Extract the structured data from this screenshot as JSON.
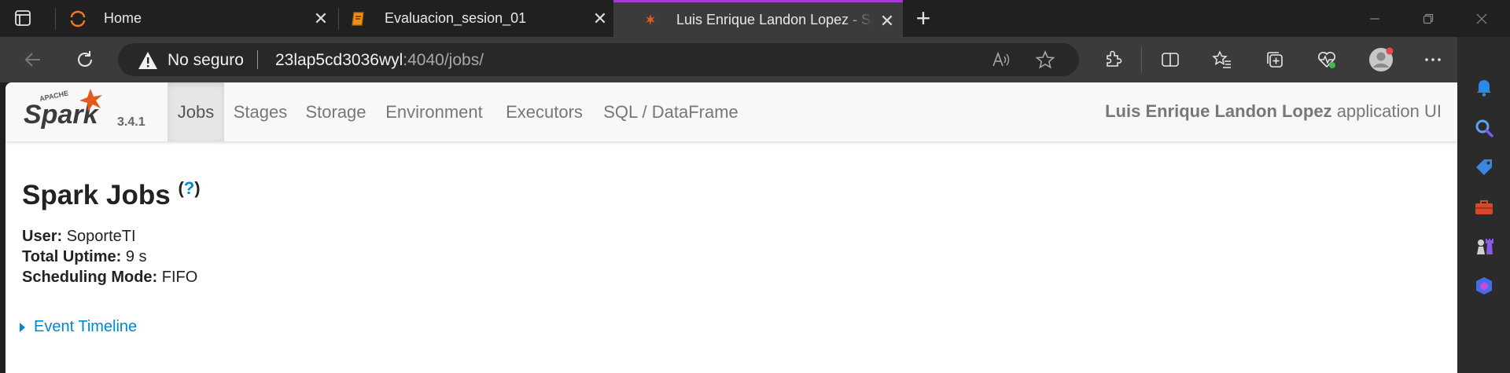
{
  "browser": {
    "tabs": [
      {
        "title": "Home",
        "icon": "jupyter-icon"
      },
      {
        "title": "Evaluacion_sesion_01",
        "icon": "notebook-icon"
      },
      {
        "title": "Luis Enrique Landon Lopez - Spark Jobs",
        "icon": "spark-icon",
        "active": true
      }
    ],
    "address": {
      "security_label": "No seguro",
      "host": "23lap5cd3036wyl",
      "path": ":4040/jobs/"
    },
    "accent_color": "#a53ad6"
  },
  "spark_ui": {
    "brand_text": "Spark",
    "brand_sub": "APACHE",
    "version": "3.4.1",
    "nav": [
      "Jobs",
      "Stages",
      "Storage",
      "Environment",
      "Executors",
      "SQL / DataFrame"
    ],
    "active_nav": "Jobs",
    "app_name": "Luis Enrique Landon Lopez",
    "app_suffix": "application UI",
    "page_title": "Spark Jobs",
    "help_link": "?",
    "summary": {
      "user_label": "User:",
      "user_value": "SoporteTI",
      "uptime_label": "Total Uptime:",
      "uptime_value": "9 s",
      "mode_label": "Scheduling Mode:",
      "mode_value": "FIFO"
    },
    "event_timeline": "Event Timeline",
    "link_color": "#0088cc"
  }
}
